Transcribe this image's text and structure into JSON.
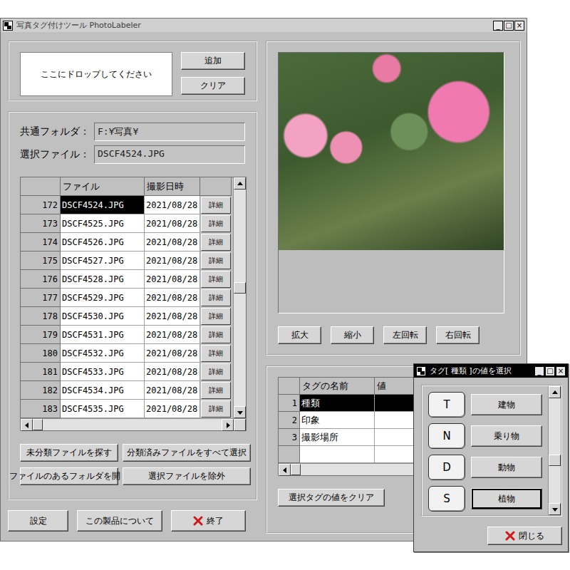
{
  "window": {
    "title": "写真タグ付けツール PhotoLabeler",
    "controls": [
      "_",
      "□",
      "×"
    ]
  },
  "drop_area": {
    "placeholder": "ここにドロップしてください",
    "buttons": [
      "追加",
      "クリア"
    ]
  },
  "fields": [
    {
      "label": "共通フォルダ：",
      "value": "F:¥写真¥"
    },
    {
      "label": "選択ファイル：",
      "value": "DSCF4524.JPG"
    }
  ],
  "file_table": {
    "columns": [
      "",
      "ファイル",
      "撮影日時",
      ""
    ],
    "scroll_position": 0.45,
    "h_scroll_position": 0,
    "rows": [
      {
        "no": "172",
        "file": "DSCF4524.JPG",
        "date": "2021/08/28",
        "detail": "詳細",
        "selected": true
      },
      {
        "no": "173",
        "file": "DSCF4525.JPG",
        "date": "2021/08/28",
        "detail": "詳細",
        "selected": false
      },
      {
        "no": "174",
        "file": "DSCF4526.JPG",
        "date": "2021/08/28",
        "detail": "詳細",
        "selected": false
      },
      {
        "no": "175",
        "file": "DSCF4527.JPG",
        "date": "2021/08/28",
        "detail": "詳細",
        "selected": false
      },
      {
        "no": "176",
        "file": "DSCF4528.JPG",
        "date": "2021/08/28",
        "detail": "詳細",
        "selected": false
      },
      {
        "no": "177",
        "file": "DSCF4529.JPG",
        "date": "2021/08/28",
        "detail": "詳細",
        "selected": false
      },
      {
        "no": "178",
        "file": "DSCF4530.JPG",
        "date": "2021/08/28",
        "detail": "詳細",
        "selected": false
      },
      {
        "no": "179",
        "file": "DSCF4531.JPG",
        "date": "2021/08/28",
        "detail": "詳細",
        "selected": false
      },
      {
        "no": "180",
        "file": "DSCF4532.JPG",
        "date": "2021/08/28",
        "detail": "詳細",
        "selected": false
      },
      {
        "no": "181",
        "file": "DSCF4533.JPG",
        "date": "2021/08/28",
        "detail": "詳細",
        "selected": false
      },
      {
        "no": "182",
        "file": "DSCF4534.JPG",
        "date": "2021/08/28",
        "detail": "詳細",
        "selected": false
      },
      {
        "no": "183",
        "file": "DSCF4535.JPG",
        "date": "2021/08/28",
        "detail": "詳細",
        "selected": false
      }
    ]
  },
  "file_actions": [
    "未分類ファイルを探す",
    "分類済みファイルをすべて選択",
    "ファイルのあるフォルダを開く",
    "選択ファイルを除外"
  ],
  "footer_buttons": [
    {
      "label": "設定",
      "kind": "plain"
    },
    {
      "label": "この製品について",
      "kind": "plain"
    },
    {
      "label": "終了",
      "kind": "exit"
    }
  ],
  "viewer": {
    "buttons": [
      "拡大",
      "縮小",
      "左回転",
      "右回転"
    ]
  },
  "tag_table": {
    "columns": [
      "",
      "タグの名前",
      "値"
    ],
    "h_scroll_position": 0,
    "rows": [
      {
        "no": "1",
        "name": "種類",
        "value": "",
        "selected": true
      },
      {
        "no": "2",
        "name": "印象",
        "value": "",
        "selected": false
      },
      {
        "no": "3",
        "name": "撮影場所",
        "value": "",
        "selected": false
      },
      {
        "no": "",
        "name": "",
        "value": "",
        "selected": false
      }
    ]
  },
  "tag_clear_button": "選択タグの値をクリア",
  "dialog": {
    "title": "タグ[ 種類 ]の値を選択",
    "controls": [
      "_",
      "□",
      "×"
    ],
    "scroll_position": 0.6,
    "options": [
      {
        "key": "T",
        "label": "建物",
        "selected": false
      },
      {
        "key": "N",
        "label": "乗り物",
        "selected": false
      },
      {
        "key": "D",
        "label": "動物",
        "selected": false
      },
      {
        "key": "S",
        "label": "植物",
        "selected": true
      }
    ],
    "close_button": "閉じる"
  }
}
